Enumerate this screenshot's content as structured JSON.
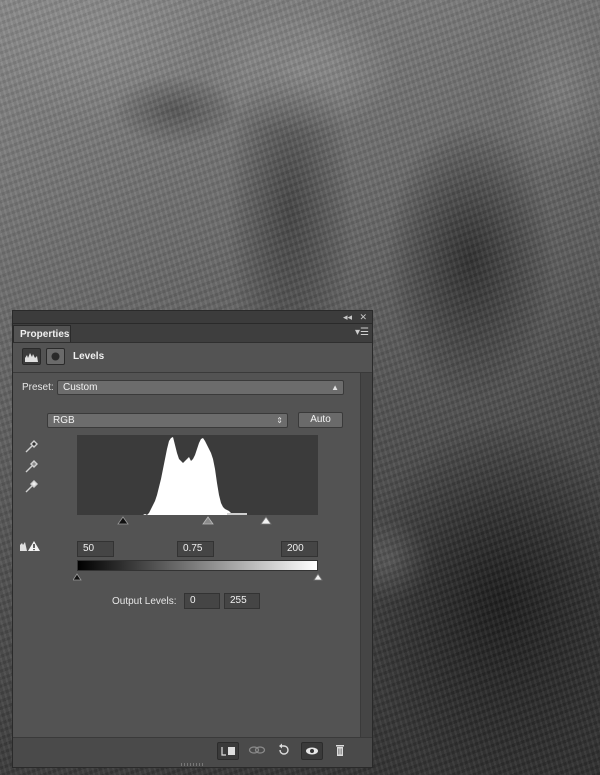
{
  "panel": {
    "tab_label": "Properties",
    "adjustment_title": "Levels",
    "preset_label": "Preset:",
    "preset_value": "Custom",
    "channel_value": "RGB",
    "auto_label": "Auto",
    "input_levels": {
      "black": "50",
      "midtone": "0.75",
      "white": "200"
    },
    "output_levels_label": "Output Levels:",
    "output_levels": {
      "black": "0",
      "white": "255"
    }
  },
  "icons": {
    "collapse": "double-chevron-icon",
    "close": "close-icon",
    "panel_menu": "panel-menu-icon",
    "clip": "clip-to-layer-icon",
    "view_previous": "view-previous-state-icon",
    "reset": "reset-icon",
    "visibility": "eye-icon",
    "delete": "trash-icon"
  },
  "colors": {
    "panel_bg": "#535353",
    "histogram_bg": "#3b3b3b",
    "histogram_fill": "#ffffff"
  }
}
